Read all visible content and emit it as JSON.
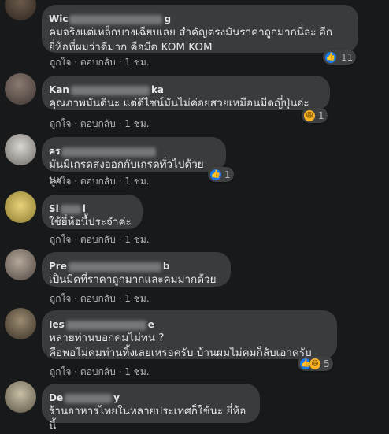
{
  "ui": {
    "like": "ถูกใจ",
    "reply": "ตอบกลับ",
    "sep": "·",
    "colors": {
      "bg": "#18191a",
      "bubble": "#3a3b3c",
      "muted": "#b0b3b8",
      "like": "#1877f2",
      "haha": "#f7b125"
    }
  },
  "comments": [
    {
      "name_start": "Wic",
      "name_end": "g",
      "text": "คมจริงแต่เหล็กบางเฉียบเลย สำคัญตรงมันราคาถูกมากนี่ล่ะ อีก\nยี่ห้อที่ผมว่าดีมาก คือมีด KOM KOM",
      "time": "1 ชม.",
      "reactions": {
        "icons": [
          "like-icon"
        ],
        "count": "11"
      }
    },
    {
      "name_start": "Kan",
      "name_end": "ka",
      "text": "คุณภาพมันดีนะ แต่ดีไซน์มันไม่ค่อยสวยเหมือนมีดญี่ปุ่นอ่ะ",
      "time": "1 ชม.",
      "reactions": {
        "icons": [
          "haha-icon"
        ],
        "count": "1"
      }
    },
    {
      "name_start": "คร",
      "name_end": "",
      "text": "มันมีเกรดส่งออกกับเกรดทั่วไปด้วยนะ",
      "time": "1 ชม.",
      "reactions": {
        "icons": [
          "like-icon"
        ],
        "count": "1"
      }
    },
    {
      "name_start": "Si",
      "name_end": "i",
      "text": "ใช้ยี่ห้อนี้ประจำค่ะ",
      "time": "1 ชม.",
      "reactions": null
    },
    {
      "name_start": "Pre",
      "name_end": "b",
      "text": "เป็นมีดที่ราคาถูกมากและคมมากด้วย",
      "time": "1 ชม.",
      "reactions": null
    },
    {
      "name_start": "Ies",
      "name_end": "e",
      "text": "หลายท่านบอกคมไม่ทน ?\nคือพอไม่คมท่านทิ้งเลยเหรอครับ บ้านผมไม่คมก็ลับเอาครับ",
      "time": "1 ชม.",
      "reactions": {
        "icons": [
          "like-icon",
          "haha-icon"
        ],
        "count": "5"
      }
    },
    {
      "name_start": "De",
      "name_end": "y",
      "text": "ร้านอาหารไทยในหลายประเทศก็ใช้นะ ยี่ห้อนี้",
      "time": "",
      "reactions": null
    }
  ]
}
